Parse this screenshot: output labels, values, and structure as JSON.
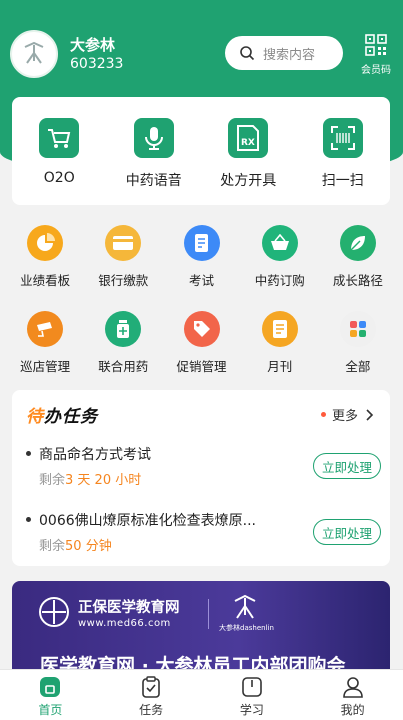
{
  "header": {
    "user_name": "大参林",
    "user_id": "603233",
    "search_placeholder": "搜索内容",
    "member_code_label": "会员码"
  },
  "quick_actions": [
    {
      "label": "O2O",
      "icon": "cart-icon"
    },
    {
      "label": "中药语音",
      "icon": "microphone-icon"
    },
    {
      "label": "处方开具",
      "icon": "prescription-icon"
    },
    {
      "label": "扫一扫",
      "icon": "scan-icon"
    }
  ],
  "grid_items": [
    {
      "label": "业绩看板",
      "icon": "pie-chart-icon",
      "color": "#f7a81c"
    },
    {
      "label": "银行缴款",
      "icon": "bank-card-icon",
      "color": "#f5b73a"
    },
    {
      "label": "考试",
      "icon": "exam-doc-icon",
      "color": "#3d8af7"
    },
    {
      "label": "中药订购",
      "icon": "basket-icon",
      "color": "#20b47a"
    },
    {
      "label": "成长路径",
      "icon": "leaf-icon",
      "color": "#24b06f"
    },
    {
      "label": "巡店管理",
      "icon": "camera-icon",
      "color": "#f28a1e"
    },
    {
      "label": "联合用药",
      "icon": "medicine-bottle-icon",
      "color": "#21ad78"
    },
    {
      "label": "促销管理",
      "icon": "tag-icon",
      "color": "#f2654a"
    },
    {
      "label": "月刊",
      "icon": "magazine-icon",
      "color": "#f5a623"
    },
    {
      "label": "全部",
      "icon": "all-apps-icon",
      "color": "#f0f0f0"
    }
  ],
  "todo": {
    "title_prefix": "待",
    "title_rest": "办任务",
    "more_label": "更多",
    "tasks": [
      {
        "name": "商品命名方式考试",
        "remain_label": "剩余",
        "remain_time": "3 天 20 小时",
        "action": "立即处理"
      },
      {
        "name": "0066佛山燎原标准化检查表燎原...",
        "remain_label": "剩余",
        "remain_time": "50 分钟",
        "action": "立即处理"
      }
    ]
  },
  "banner": {
    "brand": "正保医学教育网",
    "url": "www.med66.com",
    "partner": "大参林dashenlin",
    "headline": "医学教育网 · 大参林员工内部团购会"
  },
  "tabbar": [
    {
      "label": "首页",
      "icon": "home-icon",
      "active": true
    },
    {
      "label": "任务",
      "icon": "task-clipboard-icon",
      "active": false
    },
    {
      "label": "学习",
      "icon": "study-book-icon",
      "active": false
    },
    {
      "label": "我的",
      "icon": "profile-icon",
      "active": false
    }
  ],
  "colors": {
    "brand_green": "#1fa271",
    "accent_orange": "#f5851f",
    "banner_purple": "#3a2a80"
  }
}
